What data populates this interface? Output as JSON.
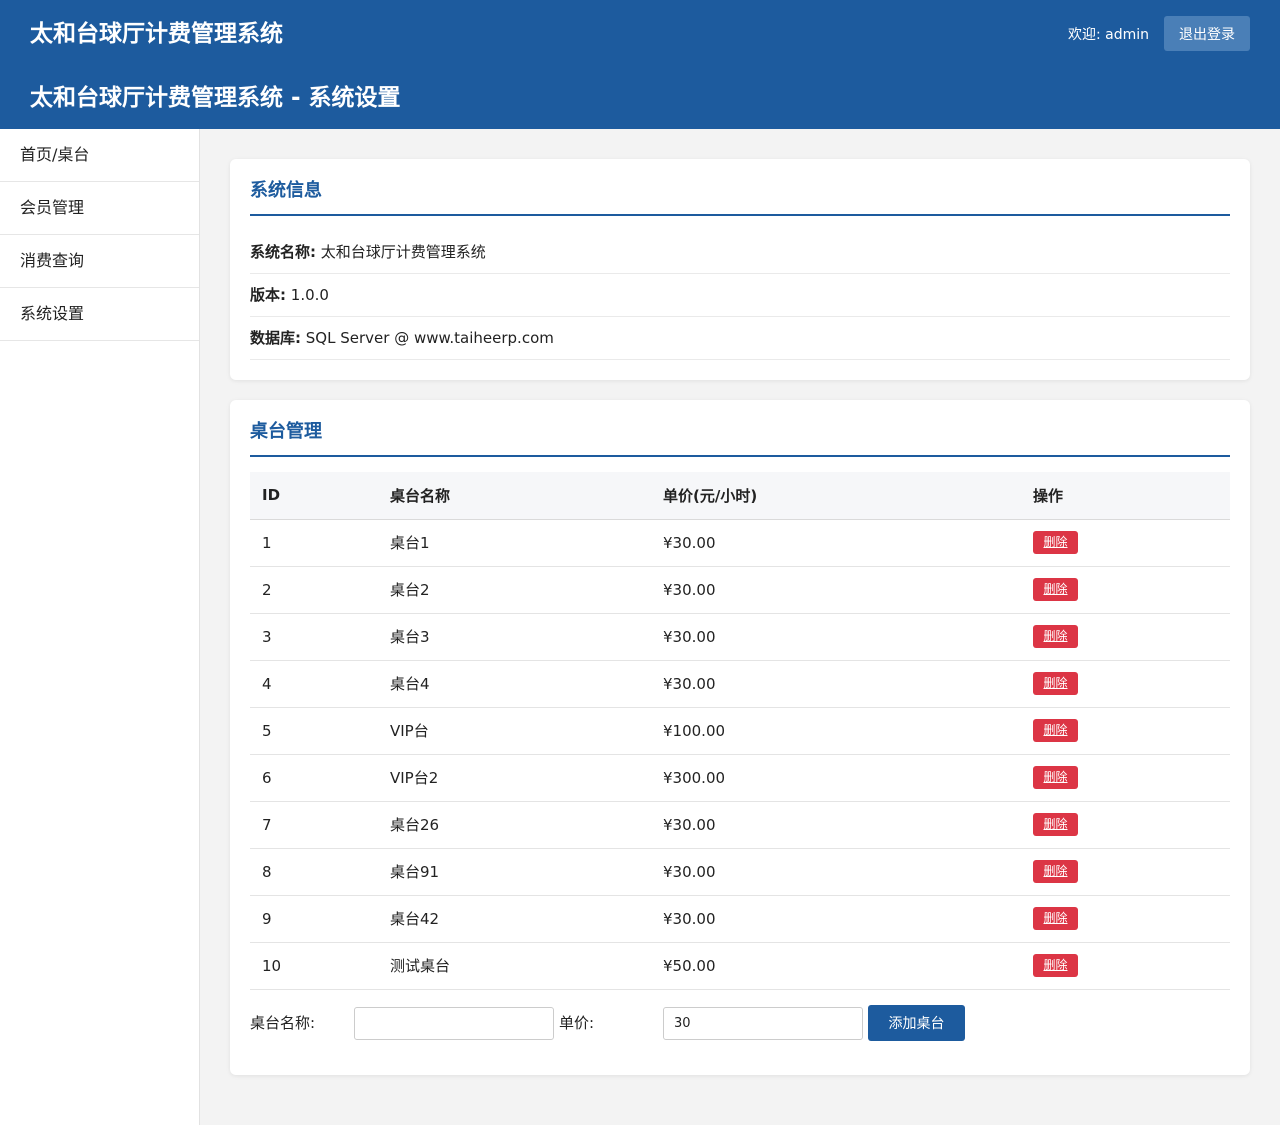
{
  "header": {
    "brand": "太和台球厅计费管理系统",
    "page_heading": "太和台球厅计费管理系统 - 系统设置",
    "welcome": "欢迎: admin",
    "logout_label": "退出登录"
  },
  "sidebar": {
    "items": [
      {
        "label": "首页/桌台"
      },
      {
        "label": "会员管理"
      },
      {
        "label": "消费查询"
      },
      {
        "label": "系统设置"
      }
    ]
  },
  "system_info": {
    "title": "系统信息",
    "rows": [
      {
        "key": "系统名称:",
        "value": "太和台球厅计费管理系统"
      },
      {
        "key": "版本:",
        "value": "1.0.0"
      },
      {
        "key": "数据库:",
        "value": "SQL Server @ www.taiheerp.com"
      }
    ]
  },
  "table_mgmt": {
    "title": "桌台管理",
    "columns": [
      "ID",
      "桌台名称",
      "单价(元/小时)",
      "操作"
    ],
    "rows": [
      {
        "id": "1",
        "name": "桌台1",
        "price": "¥30.00",
        "action": "删除"
      },
      {
        "id": "2",
        "name": "桌台2",
        "price": "¥30.00",
        "action": "删除"
      },
      {
        "id": "3",
        "name": "桌台3",
        "price": "¥30.00",
        "action": "删除"
      },
      {
        "id": "4",
        "name": "桌台4",
        "price": "¥30.00",
        "action": "删除"
      },
      {
        "id": "5",
        "name": "VIP台",
        "price": "¥100.00",
        "action": "删除"
      },
      {
        "id": "6",
        "name": "VIP台2",
        "price": "¥300.00",
        "action": "删除"
      },
      {
        "id": "7",
        "name": "桌台26",
        "price": "¥30.00",
        "action": "删除"
      },
      {
        "id": "8",
        "name": "桌台91",
        "price": "¥30.00",
        "action": "删除"
      },
      {
        "id": "9",
        "name": "桌台42",
        "price": "¥30.00",
        "action": "删除"
      },
      {
        "id": "10",
        "name": "测试桌台",
        "price": "¥50.00",
        "action": "删除"
      }
    ],
    "add_form": {
      "name_label": "桌台名称:",
      "name_value": "",
      "price_label": "单价:",
      "price_value": "30",
      "add_label": "添加桌台"
    }
  },
  "colors": {
    "primary": "#1d5b9e",
    "danger": "#dc3545",
    "background": "#f3f3f3"
  }
}
